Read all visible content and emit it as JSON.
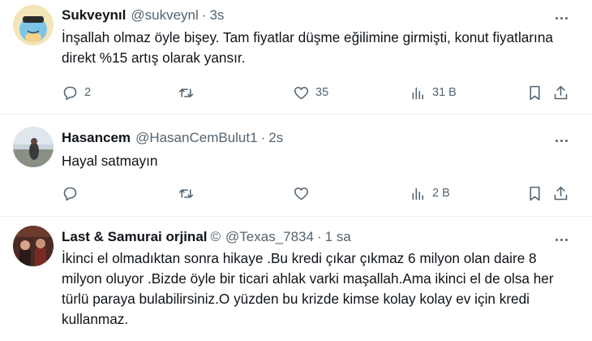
{
  "tweets": [
    {
      "name": "Sukveynıl",
      "handle": "@sukveynl",
      "dot": "·",
      "time": "3s",
      "text": "İnşallah olmaz öyle bişey. Tam fiyatlar düşme eğilimine girmişti, konut fiyatlarına direkt %15 artış olarak yansır.",
      "replies": "2",
      "retweets": "",
      "likes": "35",
      "views": "31 B"
    },
    {
      "name": "Hasancem",
      "handle": "@HasanCemBulut1",
      "dot": "·",
      "time": "2s",
      "text": "Hayal satmayın",
      "replies": "",
      "retweets": "",
      "likes": "",
      "views": "2 B"
    },
    {
      "name": "Last & Samurai orjinal",
      "badge": "©",
      "handle": "@Texas_7834",
      "dot": "·",
      "time": "1 sa",
      "text": "İkinci el olmadıktan sonra hikaye .Bu kredi çıkar çıkmaz 6 milyon olan daire 8 milyon oluyor .Bizde öyle bir ticari  ahlak varki maşallah.Ama ikinci el de olsa her türlü paraya bulabilirsiniz.O yüzden bu krizde kimse kolay kolay ev için kredi kullanmaz."
    }
  ],
  "icons": [
    "reply-icon",
    "retweet-icon",
    "like-icon",
    "views-icon",
    "bookmark-icon",
    "share-icon",
    "more-icon"
  ],
  "colors": {
    "text": "#0f1419",
    "secondary": "#536471",
    "divider": "#eff3f4"
  }
}
